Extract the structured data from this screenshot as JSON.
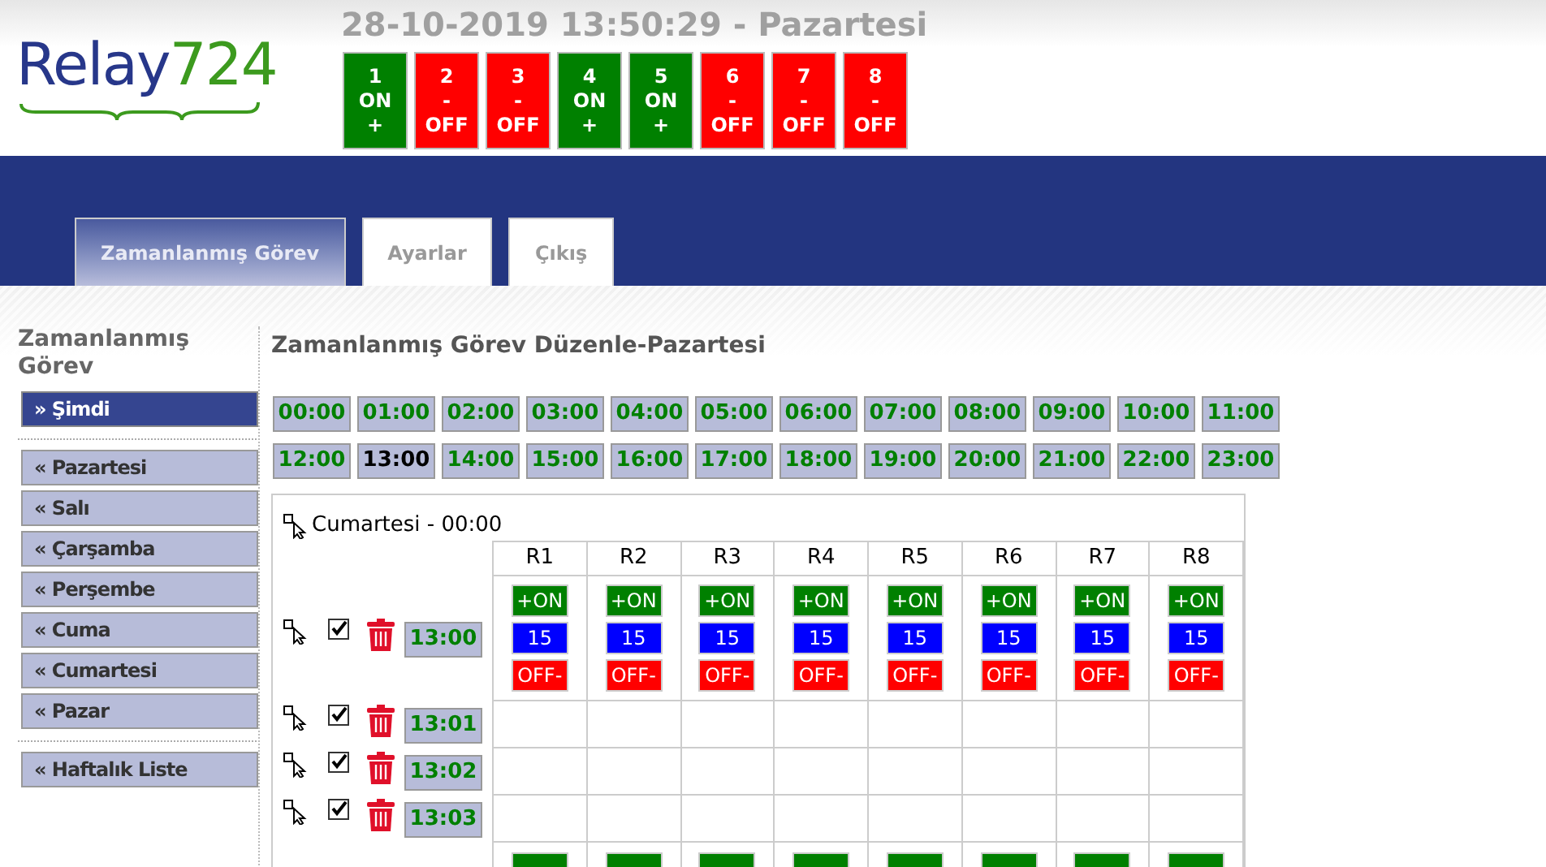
{
  "logo": {
    "word": "Relay",
    "number": "724"
  },
  "datetime": "28-10-2019 13:50:29 - Pazartesi",
  "relays": [
    {
      "number": "1",
      "line1": "ON",
      "line2": "+",
      "on": true
    },
    {
      "number": "2",
      "line1": "-",
      "line2": "OFF",
      "on": false
    },
    {
      "number": "3",
      "line1": "-",
      "line2": "OFF",
      "on": false
    },
    {
      "number": "4",
      "line1": "ON",
      "line2": "+",
      "on": true
    },
    {
      "number": "5",
      "line1": "ON",
      "line2": "+",
      "on": true
    },
    {
      "number": "6",
      "line1": "-",
      "line2": "OFF",
      "on": false
    },
    {
      "number": "7",
      "line1": "-",
      "line2": "OFF",
      "on": false
    },
    {
      "number": "8",
      "line1": "-",
      "line2": "OFF",
      "on": false
    }
  ],
  "tabs": [
    {
      "label": "Zamanlanmış Görev",
      "selected": true
    },
    {
      "label": "Ayarlar",
      "selected": false
    },
    {
      "label": "Çıkış",
      "selected": false
    }
  ],
  "sidebar": {
    "title": "Zamanlanmış Görev",
    "sections": [
      [
        {
          "label": "» Şimdi",
          "selected": true
        }
      ],
      [
        {
          "label": "« Pazartesi",
          "selected": false
        },
        {
          "label": "« Salı",
          "selected": false
        },
        {
          "label": "« Çarşamba",
          "selected": false
        },
        {
          "label": "« Perşembe",
          "selected": false
        },
        {
          "label": "« Cuma",
          "selected": false
        },
        {
          "label": "« Cumartesi",
          "selected": false
        },
        {
          "label": "« Pazar",
          "selected": false
        }
      ],
      [
        {
          "label": "« Haftalık Liste",
          "selected": false
        }
      ]
    ]
  },
  "main": {
    "title": "Zamanlanmış Görev Düzenle-Pazartesi",
    "hours": [
      {
        "label": "00:00",
        "selected": false
      },
      {
        "label": "01:00",
        "selected": false
      },
      {
        "label": "02:00",
        "selected": false
      },
      {
        "label": "03:00",
        "selected": false
      },
      {
        "label": "04:00",
        "selected": false
      },
      {
        "label": "05:00",
        "selected": false
      },
      {
        "label": "06:00",
        "selected": false
      },
      {
        "label": "07:00",
        "selected": false
      },
      {
        "label": "08:00",
        "selected": false
      },
      {
        "label": "09:00",
        "selected": false
      },
      {
        "label": "10:00",
        "selected": false
      },
      {
        "label": "11:00",
        "selected": false
      },
      {
        "label": "12:00",
        "selected": false
      },
      {
        "label": "13:00",
        "selected": true
      },
      {
        "label": "14:00",
        "selected": false
      },
      {
        "label": "15:00",
        "selected": false
      },
      {
        "label": "16:00",
        "selected": false
      },
      {
        "label": "17:00",
        "selected": false
      },
      {
        "label": "18:00",
        "selected": false
      },
      {
        "label": "19:00",
        "selected": false
      },
      {
        "label": "20:00",
        "selected": false
      },
      {
        "label": "21:00",
        "selected": false
      },
      {
        "label": "22:00",
        "selected": false
      },
      {
        "label": "23:00",
        "selected": false
      }
    ],
    "schedule": {
      "copy_label": "Cumartesi - 00:00",
      "columns": [
        "R1",
        "R2",
        "R3",
        "R4",
        "R5",
        "R6",
        "R7",
        "R8"
      ],
      "rows": [
        {
          "kind": "full",
          "time": "13:00",
          "checked": true,
          "cells": [
            {
              "on": "+ON",
              "value": "15",
              "off": "OFF-"
            },
            {
              "on": "+ON",
              "value": "15",
              "off": "OFF-"
            },
            {
              "on": "+ON",
              "value": "15",
              "off": "OFF-"
            },
            {
              "on": "+ON",
              "value": "15",
              "off": "OFF-"
            },
            {
              "on": "+ON",
              "value": "15",
              "off": "OFF-"
            },
            {
              "on": "+ON",
              "value": "15",
              "off": "OFF-"
            },
            {
              "on": "+ON",
              "value": "15",
              "off": "OFF-"
            },
            {
              "on": "+ON",
              "value": "15",
              "off": "OFF-"
            }
          ]
        },
        {
          "kind": "empty",
          "time": "13:01",
          "checked": true
        },
        {
          "kind": "empty",
          "time": "13:02",
          "checked": true
        },
        {
          "kind": "empty",
          "time": "13:03",
          "checked": true
        },
        {
          "kind": "cut"
        }
      ]
    }
  }
}
